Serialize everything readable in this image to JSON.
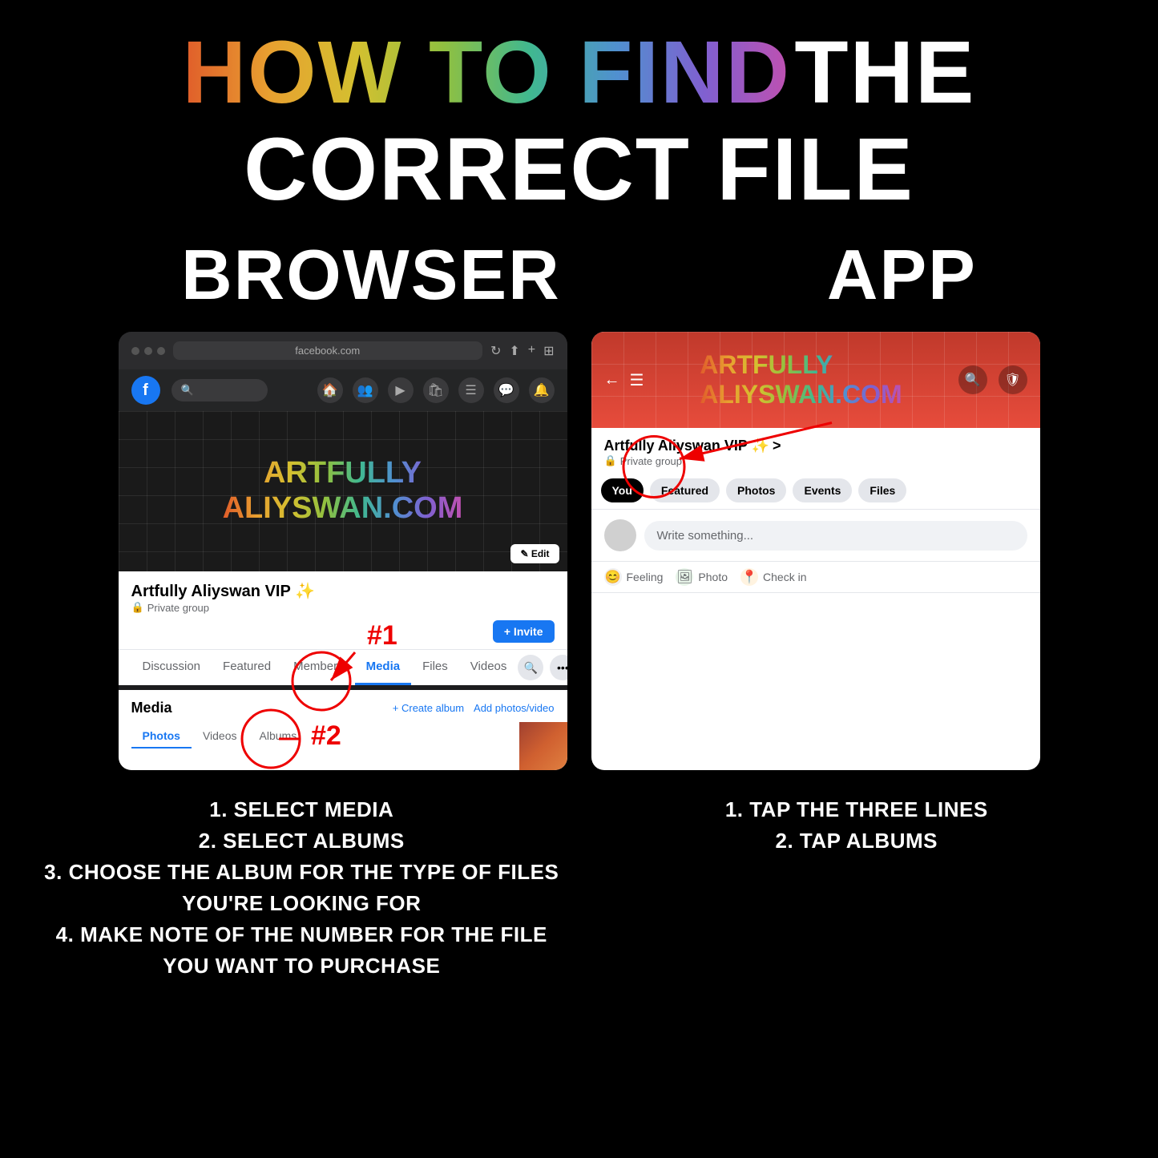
{
  "title": {
    "line1_part1": "HOW TO FIND",
    "line1_part2": "THE CORRECT FILE"
  },
  "sections": {
    "browser": "BROWSER",
    "app": "APP"
  },
  "browser": {
    "url": "facebook.com",
    "cover_title_line1": "ARTFULLY",
    "cover_title_line2": "ALIYSWAN.COM",
    "group_name": "Artfully Aliyswan VIP ✨",
    "group_type": "Private group",
    "invite_btn": "+ Invite",
    "edit_btn": "✎ Edit",
    "nav_tabs": [
      "Discussion",
      "Featured",
      "Members",
      "Media",
      "Files",
      "Videos"
    ],
    "active_tab": "Media",
    "annotation_1": "#1",
    "annotation_2": "#2",
    "media_title": "Media",
    "create_album": "+ Create album",
    "add_photos": "Add photos/video",
    "sub_tabs": [
      "Photos",
      "Videos",
      "Albums"
    ],
    "active_sub_tab": "Photos"
  },
  "app": {
    "cover_title_line1": "ARTFULLY",
    "cover_title_line2": "ALIYSWAN.COM",
    "group_name": "Artfully Aliyswan VIP ✨",
    "chevron": ">",
    "group_type": "Private group",
    "tabs": [
      "You",
      "Featured",
      "Photos",
      "Events",
      "Files"
    ],
    "active_tab": "You",
    "write_placeholder": "Write something...",
    "actions": {
      "feeling": "Feeling",
      "photo": "Photo",
      "checkin": "Check in"
    }
  },
  "instructions": {
    "browser": {
      "line1": "1. SELECT MEDIA",
      "line2": "2. SELECT ALBUMS",
      "line3": "3. CHOOSE THE ALBUM FOR THE TYPE OF FILES YOU'RE LOOKING FOR",
      "line4": "4. MAKE NOTE OF THE NUMBER FOR THE FILE YOU WANT TO PURCHASE"
    },
    "app": {
      "line1": "1. TAP THE THREE LINES",
      "line2": "2. TAP ALBUMS"
    }
  }
}
